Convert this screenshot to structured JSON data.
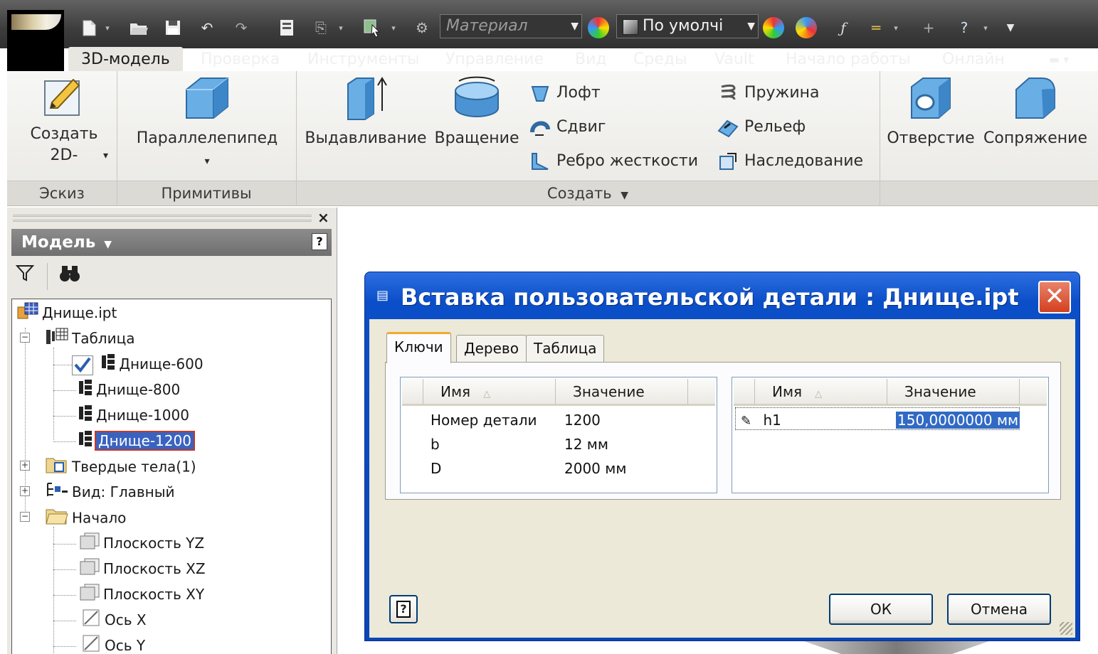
{
  "quick_access": {
    "material_placeholder": "Материал",
    "appearance_value": "По умолчі",
    "icons": [
      "new-icon",
      "open-icon",
      "save-icon",
      "undo-icon",
      "redo-icon",
      "print-icon",
      "return-icon",
      "select-icon",
      "color-override-icon",
      "fx-icon",
      "measure-icon",
      "pan-icon",
      "help-icon"
    ]
  },
  "ribbon": {
    "tabs": [
      "3D-модель",
      "Проверка",
      "Инструменты",
      "Управление",
      "Вид",
      "Среды",
      "Vault",
      "Начало работы",
      "Онлайн"
    ],
    "active_tab": "3D-модель",
    "panels": {
      "sketch": {
        "label": "Эскиз",
        "create2d_label": "Создать",
        "create2d_sub": "2D-"
      },
      "primitives": {
        "label": "Примитивы",
        "box_label": "Параллелепипед"
      },
      "create": {
        "label": "Создать",
        "extrude": "Выдавливание",
        "revolve": "Вращение",
        "loft": "Лофт",
        "sweep": "Сдвиг",
        "rib": "Ребро жесткости",
        "coil": "Пружина",
        "emboss": "Рельеф",
        "derive": "Наследование"
      },
      "modify": {
        "hole": "Отверстие",
        "fillet": "Сопряжение"
      }
    }
  },
  "browser": {
    "title": "Модель",
    "tree": {
      "root": "Днище.ipt",
      "table": "Таблица",
      "members": [
        "Днище-600",
        "Днище-800",
        "Днище-1000",
        "Днище-1200"
      ],
      "solids": "Твердые тела(1)",
      "view": "Вид: Главный",
      "origin": "Начало",
      "origin_items": [
        "Плоскость YZ",
        "Плоскость XZ",
        "Плоскость XY",
        "Ось X",
        "Ось Y"
      ]
    }
  },
  "dialog": {
    "title": "Вставка пользовательской детали : Днище.ipt",
    "tabs": [
      "Ключи",
      "Дерево",
      "Таблица"
    ],
    "active_tab": "Ключи",
    "keys_grid": {
      "columns": [
        "Имя",
        "Значение"
      ],
      "rows": [
        {
          "name": "Номер детали",
          "value": "1200"
        },
        {
          "name": "b",
          "value": "12 мм"
        },
        {
          "name": "D",
          "value": "2000 мм"
        }
      ]
    },
    "params_grid": {
      "columns": [
        "Имя",
        "Значение"
      ],
      "rows": [
        {
          "name": "h1",
          "value": "150,0000000 мм"
        }
      ]
    },
    "ok_label": "ОК",
    "cancel_label": "Отмена"
  },
  "colors": {
    "titlebar_blue": "#0a46b8",
    "dialog_face": "#ece9d8",
    "selection": "#316ac5",
    "ribbon_dark": "#3d3d3d"
  }
}
